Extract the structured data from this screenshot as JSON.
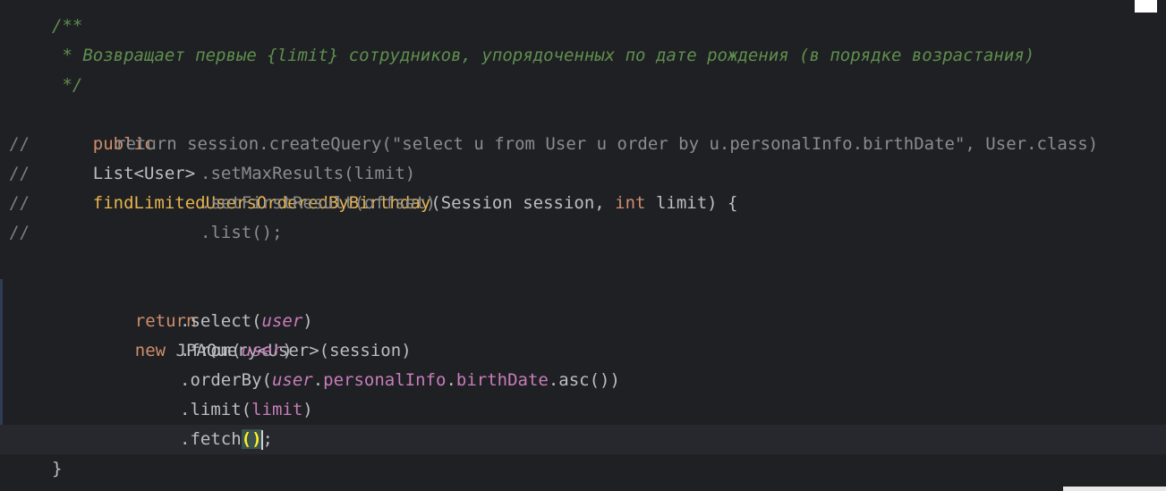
{
  "editor": {
    "lines": [
      {
        "id": "doc-open",
        "text": "/**"
      },
      {
        "id": "doc-body",
        "text": " * Возвращает первые {limit} сотрудников, упорядоченных по дате рождения (в порядке возрастания)"
      },
      {
        "id": "doc-close",
        "text": " */"
      },
      {
        "id": "signature",
        "kw_public": "public",
        "type_list": "List<User>",
        "method_name": "findLimitedUsersOrderedByBirthday",
        "params_open": "(Session session, ",
        "kw_int": "int",
        "params_close": " limit) {"
      },
      {
        "id": "commented-return",
        "text": "return session.createQuery(\"select u from User u order by u.personalInfo.birthDate\", User.class)"
      },
      {
        "id": "commented-max",
        "text": ".setMaxResults(limit)"
      },
      {
        "id": "commented-first",
        "text": ".setFirstResult(offset)"
      },
      {
        "id": "commented-list",
        "text": ".list();"
      },
      {
        "id": "return-new",
        "kw_return": "return",
        "kw_new": "new",
        "rest": " JPAQuery<User>(session)"
      },
      {
        "id": "select",
        "pre": ".select(",
        "field": "user",
        "post": ")"
      },
      {
        "id": "from",
        "pre": ".from(",
        "field": "user",
        "post": ")"
      },
      {
        "id": "orderby",
        "pre": ".orderBy(",
        "field": "user",
        "dot1": ".",
        "member1": "personalInfo",
        "dot2": ".",
        "member2": "birthDate",
        "post": ".asc())"
      },
      {
        "id": "limit",
        "pre": ".limit(",
        "arg": "limit",
        "post": ")"
      },
      {
        "id": "fetch",
        "pre": ".fetch",
        "paren": "()",
        "post": ";"
      },
      {
        "id": "close-brace",
        "text": "}"
      }
    ],
    "gutter": {
      "comment_marker": "//"
    }
  }
}
